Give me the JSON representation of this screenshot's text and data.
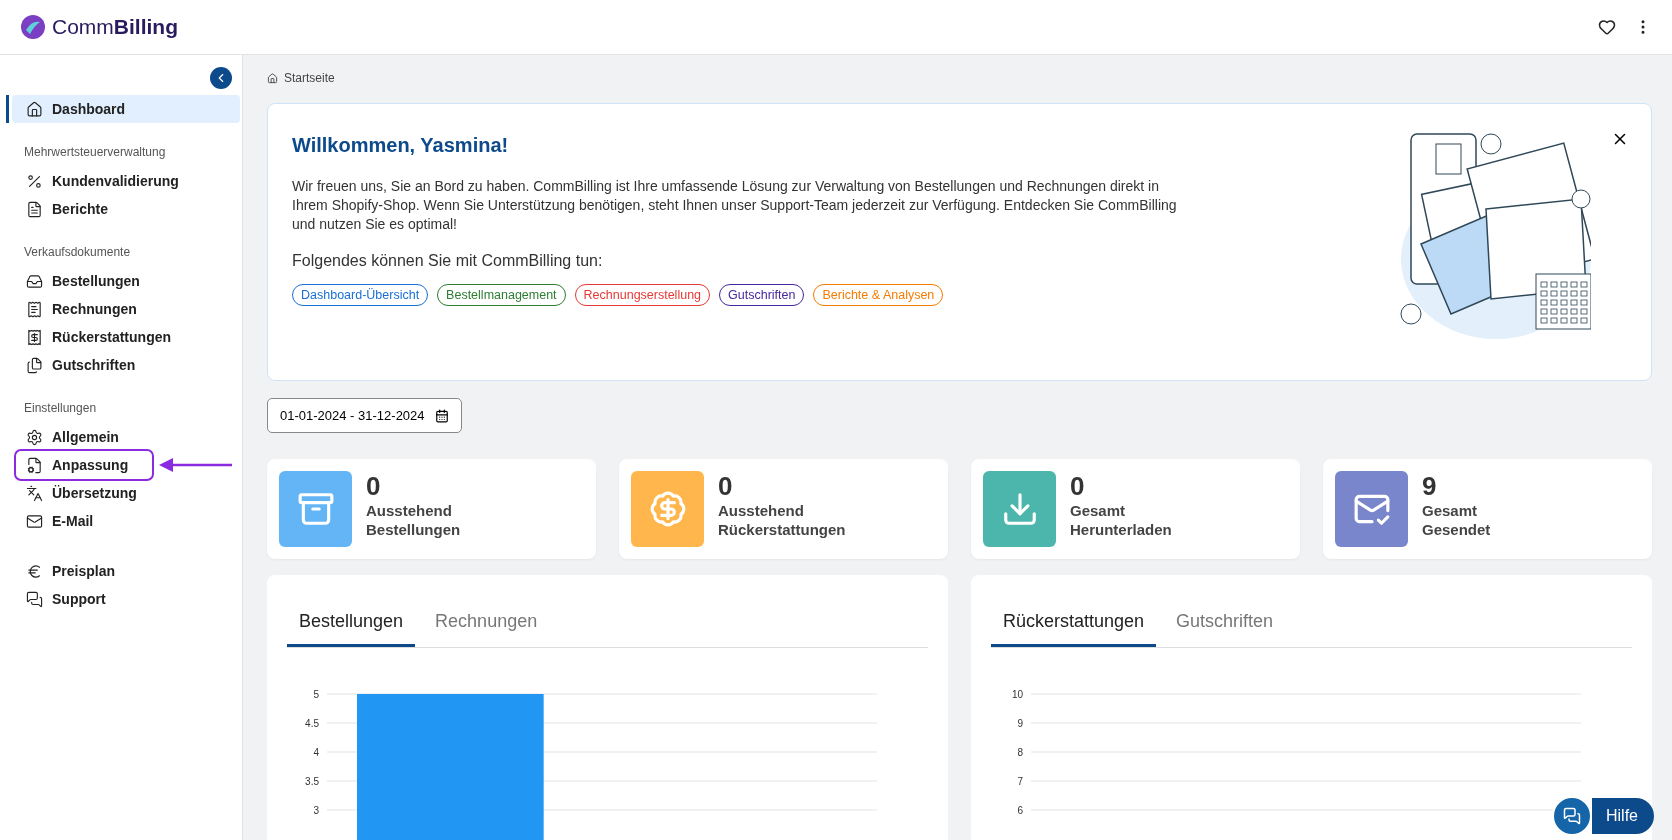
{
  "header": {
    "logo_text_light": "Comm",
    "logo_text_bold": "Billing"
  },
  "sidebar": {
    "groups": [
      {
        "items": [
          {
            "label": "Dashboard",
            "selected": true,
            "highlighted": false
          }
        ]
      },
      {
        "heading": "Mehrwertsteuerverwaltung",
        "items": [
          {
            "label": "Kundenvalidierung",
            "selected": false,
            "highlighted": false
          },
          {
            "label": "Berichte",
            "selected": false,
            "highlighted": false
          }
        ]
      },
      {
        "heading": "Verkaufsdokumente",
        "items": [
          {
            "label": "Bestellungen",
            "selected": false,
            "highlighted": false
          },
          {
            "label": "Rechnungen",
            "selected": false,
            "highlighted": false
          },
          {
            "label": "Rückerstattungen",
            "selected": false,
            "highlighted": false
          },
          {
            "label": "Gutschriften",
            "selected": false,
            "highlighted": false
          }
        ]
      },
      {
        "heading": "Einstellungen",
        "items": [
          {
            "label": "Allgemein",
            "selected": false,
            "highlighted": false
          },
          {
            "label": "Anpassung",
            "selected": false,
            "highlighted": true
          },
          {
            "label": "Übersetzung",
            "selected": false,
            "highlighted": false
          },
          {
            "label": "E-Mail",
            "selected": false,
            "highlighted": false
          }
        ]
      },
      {
        "items": [
          {
            "label": "Preisplan",
            "selected": false,
            "highlighted": false
          },
          {
            "label": "Support",
            "selected": false,
            "highlighted": false
          }
        ]
      }
    ]
  },
  "breadcrumb": "Startseite",
  "welcome": {
    "title": "Willkommen, Yasmina!",
    "text": "Wir freuen uns, Sie an Bord zu haben. CommBilling ist Ihre umfassende Lösung zur Verwaltung von Bestellungen und Rechnungen direkt in Ihrem Shopify-Shop. Wenn Sie Unterstützung benötigen, steht Ihnen unser Support-Team jederzeit zur Verfügung. Entdecken Sie CommBilling und nutzen Sie es optimal!",
    "subtitle": "Folgendes können Sie mit CommBilling tun:",
    "tags": [
      {
        "label": "Dashboard-Übersicht",
        "color": "#1a6fd6"
      },
      {
        "label": "Bestellmanagement",
        "color": "#2e7d32"
      },
      {
        "label": "Rechnungserstellung",
        "color": "#e53935"
      },
      {
        "label": "Gutschriften",
        "color": "#4527a0"
      },
      {
        "label": "Berichte & Analysen",
        "color": "#f57c00"
      }
    ]
  },
  "date_range": "01-01-2024 - 31-12-2024",
  "stats": [
    {
      "value": "0",
      "label_1": "Ausstehend",
      "label_2": "Bestellungen",
      "color": "#64b5f6"
    },
    {
      "value": "0",
      "label_1": "Ausstehend",
      "label_2": "Rückerstattungen",
      "color": "#ffb74d"
    },
    {
      "value": "0",
      "label_1": "Gesamt",
      "label_2": "Herunterladen",
      "color": "#4db6ac"
    },
    {
      "value": "9",
      "label_1": "Gesamt",
      "label_2": "Gesendet",
      "color": "#7986cb"
    }
  ],
  "panels": [
    {
      "tabs": [
        {
          "label": "Bestellungen",
          "selected": true
        },
        {
          "label": "Rechnungen",
          "selected": false
        }
      ],
      "chart_data": {
        "type": "bar",
        "values": [
          5
        ],
        "ylim": [
          0,
          5
        ],
        "yticks": [
          3,
          3.5,
          4,
          4.5,
          5
        ],
        "grid": true
      }
    },
    {
      "tabs": [
        {
          "label": "Rückerstattungen",
          "selected": true
        },
        {
          "label": "Gutschriften",
          "selected": false
        }
      ],
      "chart_data": {
        "type": "bar",
        "categories": [
          null
        ],
        "values": [
          null
        ],
        "ylim": [
          0,
          10
        ],
        "yticks": [
          6,
          7,
          8,
          9,
          10
        ],
        "grid": true
      }
    }
  ],
  "help_button": "Hilfe"
}
